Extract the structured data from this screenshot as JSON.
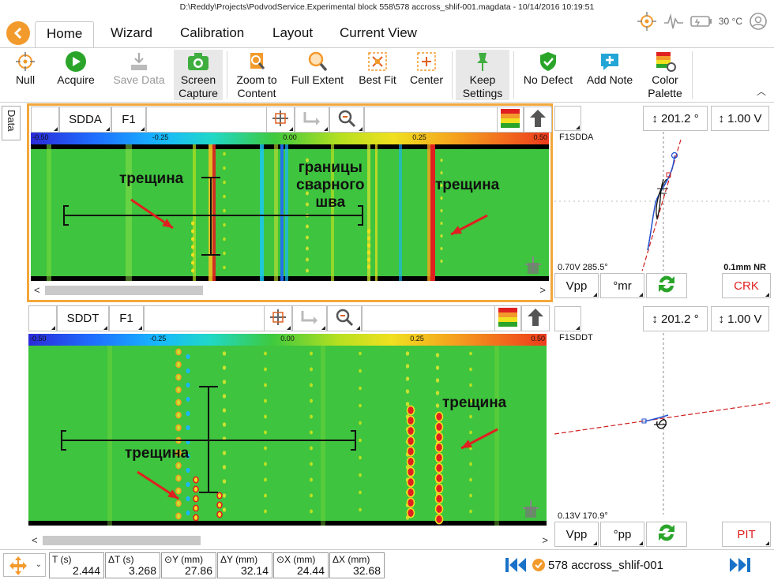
{
  "window": {
    "title": "D:\\Reddy\\Projects\\PodvodService.Experimental block 558\\578 accross_shlif-001.magdata - 10/14/2016 10:19:51",
    "temperature": "30 °C"
  },
  "tabs": [
    "Home",
    "Wizard",
    "Calibration",
    "Layout",
    "Current View"
  ],
  "ribbon": {
    "null": "Null",
    "acquire": "Acquire",
    "save_data": "Save Data",
    "screen_capture_1": "Screen",
    "screen_capture_2": "Capture",
    "zoom_content_1": "Zoom to",
    "zoom_content_2": "Content",
    "full_extent": "Full Extent",
    "best_fit": "Best Fit",
    "center": "Center",
    "keep_settings_1": "Keep",
    "keep_settings_2": "Settings",
    "no_defect": "No Defect",
    "add_note": "Add Note",
    "color_palette_1": "Color",
    "color_palette_2": "Palette"
  },
  "side_tab": "Data",
  "top_panel": {
    "channel": "SDDA",
    "frequency": "F1",
    "scale": [
      "-0.50",
      "-0.25",
      "0.00",
      "0.25",
      "0.50"
    ],
    "annotations": {
      "crack_left": "трещина",
      "weld_1": "границы",
      "weld_2": "сварного",
      "weld_3": "шва",
      "crack_right": "трещина"
    }
  },
  "bottom_panel": {
    "channel": "SDDT",
    "frequency": "F1",
    "scale": [
      "-0.50",
      "-0.25",
      "0.00",
      "0.25",
      "0.50"
    ],
    "annotations": {
      "crack_left": "трещина",
      "crack_right": "трещина"
    }
  },
  "lissajous_top": {
    "rotation": "201.2 °",
    "volts": "1.00 V",
    "label": "F1SDDA",
    "readout": "0.70V 285.5°",
    "nr": "0.1mm NR",
    "mode": "Vpp",
    "param": "°mr",
    "class": "CRK"
  },
  "lissajous_bot": {
    "rotation": "201.2 °",
    "volts": "1.00 V",
    "label": "F1SDDT",
    "readout": "0.13V 170.9°",
    "mode": "Vpp",
    "param": "°pp",
    "class": "PIT"
  },
  "measurements": [
    {
      "key": "T (s)",
      "value": "2.444"
    },
    {
      "key": "ΔT (s)",
      "value": "3.268"
    },
    {
      "key": "⊙Y (mm)",
      "value": "27.86"
    },
    {
      "key": "ΔY (mm)",
      "value": "32.14"
    },
    {
      "key": "⊙X (mm)",
      "value": "24.44"
    },
    {
      "key": "ΔX (mm)",
      "value": "32.68"
    }
  ],
  "file_nav": {
    "name": "578 accross_shlif-001"
  },
  "colors": {
    "accent": "#f39a2c",
    "scan_green": "#38c238",
    "crack_red": "#e01818",
    "ok_green": "#2aa52a"
  }
}
